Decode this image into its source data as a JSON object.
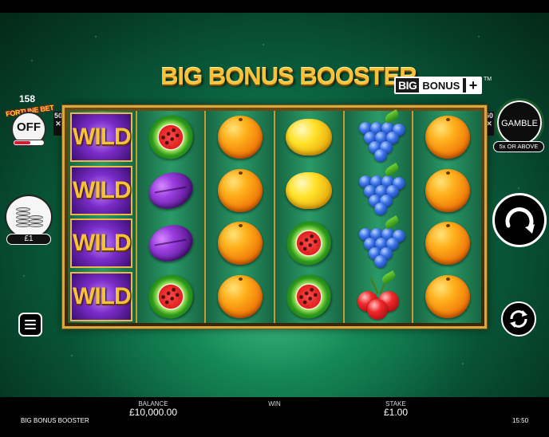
{
  "title": {
    "main": "BIG BONUS BOOSTER",
    "badge_big": "BIG",
    "badge_bonus": "BONUS",
    "badge_plus": "+",
    "tm": "TM"
  },
  "fortune_bet": {
    "count": "158",
    "label": "FORTUNE BET",
    "state": "OFF"
  },
  "stake_chip": "£1",
  "reel_multiplier_left": "50",
  "reel_multiplier_right": "50",
  "gamble": {
    "label": "GAMBLE",
    "note": "5x OR ABOVE"
  },
  "reels": [
    [
      "wild",
      "wild",
      "wild",
      "wild"
    ],
    [
      "watermelon",
      "plum",
      "plum",
      "watermelon"
    ],
    [
      "orange",
      "orange",
      "orange",
      "orange"
    ],
    [
      "lemon",
      "lemon",
      "watermelon",
      "watermelon"
    ],
    [
      "grapes",
      "grapes",
      "grapes",
      "cherries"
    ],
    [
      "orange",
      "orange",
      "orange",
      "orange"
    ]
  ],
  "wild_text": "WILD",
  "bottom": {
    "balance_label": "BALANCE",
    "balance_value": "£10,000.00",
    "win_label": "WIN",
    "win_value": "",
    "stake_label": "STAKE",
    "stake_value": "£1.00",
    "game_name": "BIG BONUS BOOSTER",
    "clock": "15:50"
  },
  "icons": {
    "menu": "hamburger-icon",
    "spin": "spin-arrow-icon",
    "autoplay": "autoplay-icon",
    "coins": "coin-stack-icon"
  },
  "colors": {
    "gold": "#f5c23a",
    "background_green": "#0b6a44",
    "wild_purple": "#7a2cc8",
    "fortune_red": "#e3142a"
  }
}
